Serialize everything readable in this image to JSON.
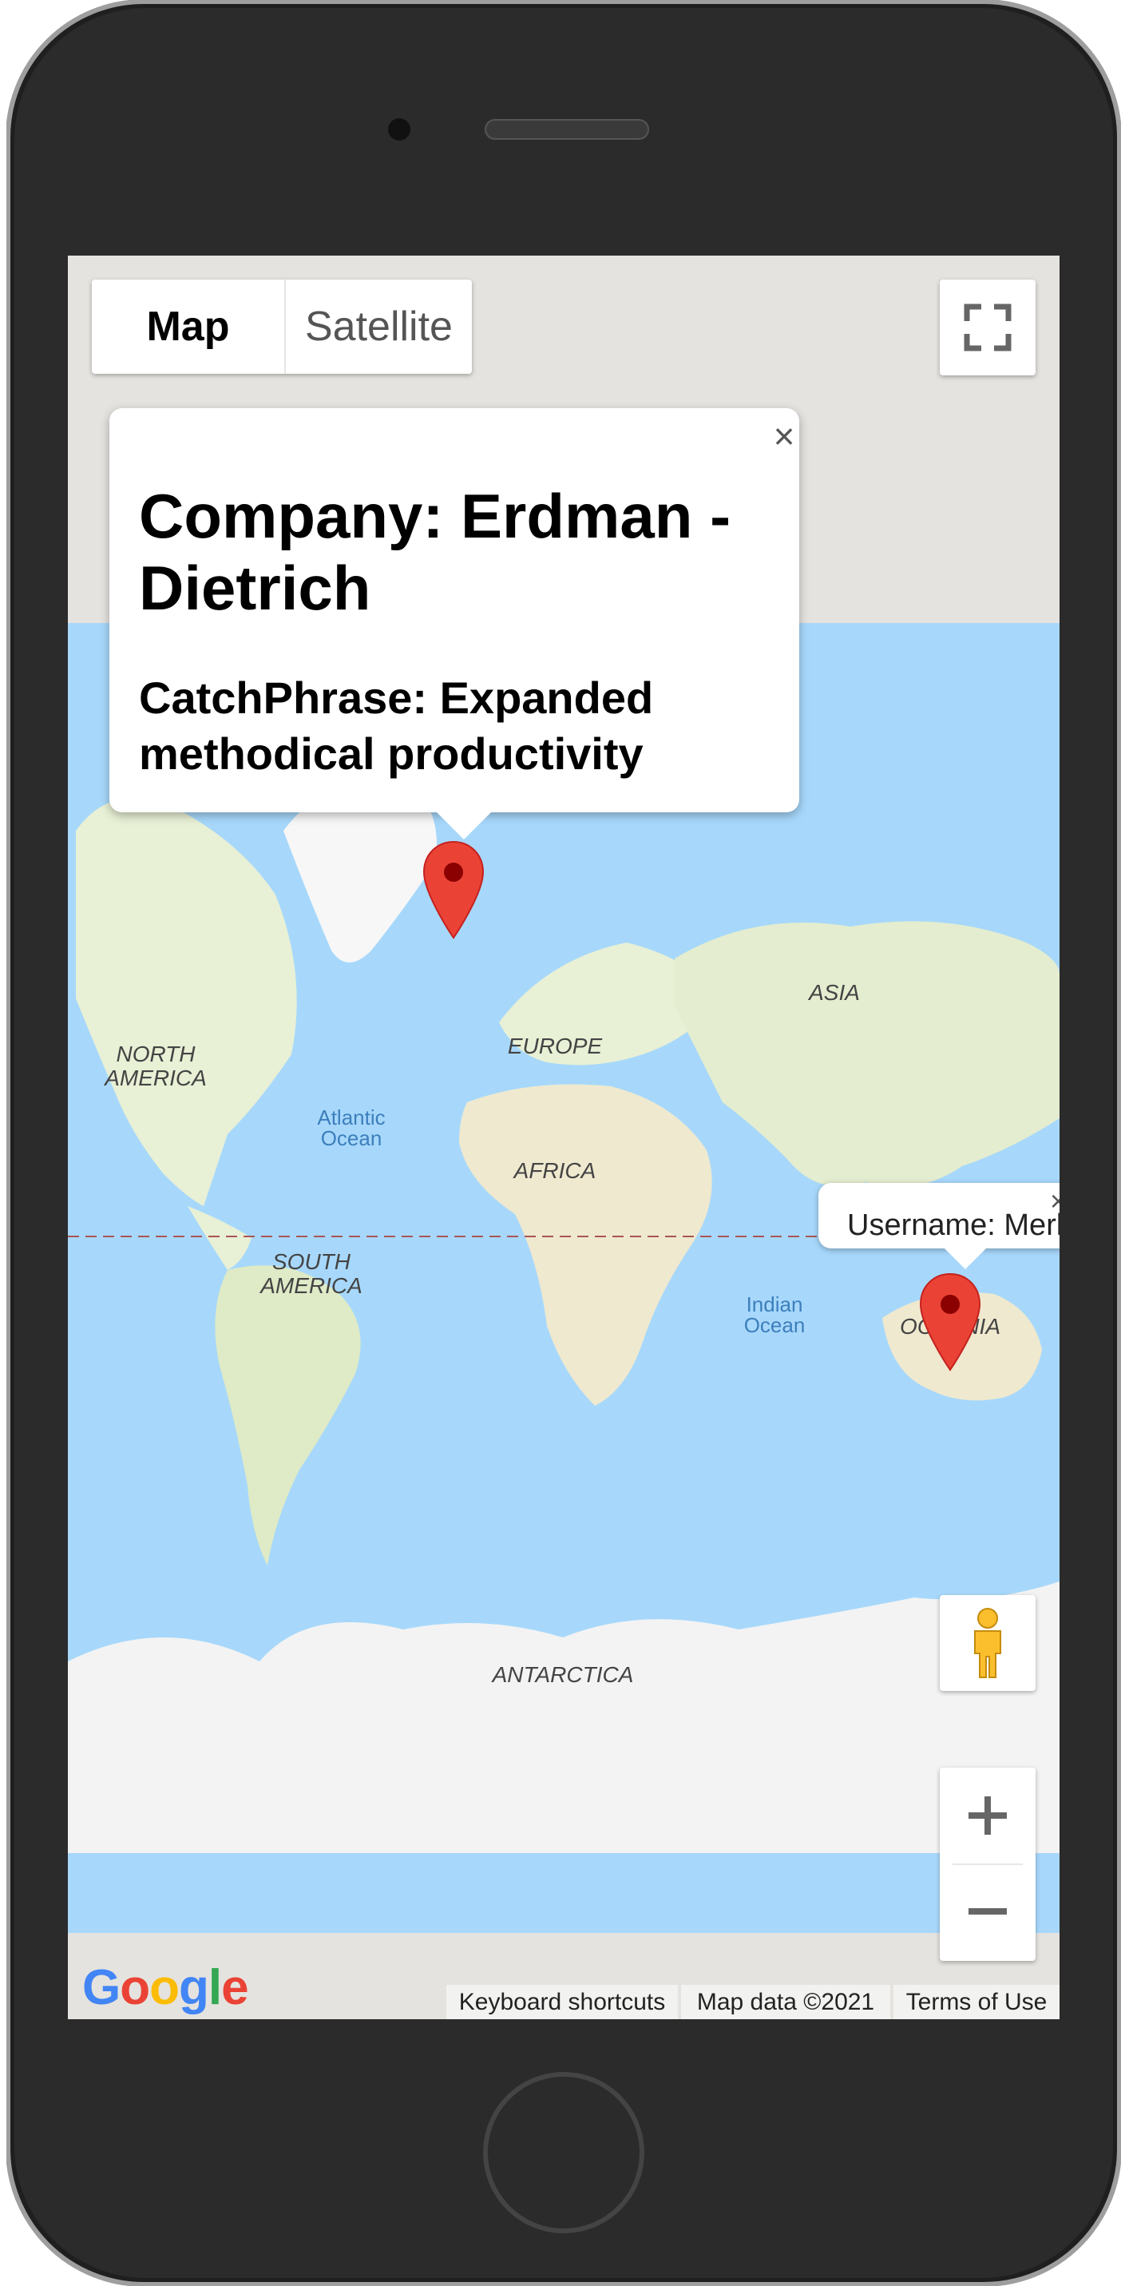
{
  "map_type": {
    "map_label": "Map",
    "satellite_label": "Satellite",
    "selected": "Map"
  },
  "info_window": {
    "company": "Company: Erdman - Dietrich",
    "catchphrase": "CatchPhrase: Expanded methodical productivity",
    "close": "×"
  },
  "info_window_2": {
    "text": "Username: Merl",
    "close": "×"
  },
  "regions": {
    "north_america": "NORTH AMERICA",
    "south_america": "SOUTH AMERICA",
    "europe": "EUROPE",
    "africa": "AFRICA",
    "asia": "ASIA",
    "oceania": "OCEANIA",
    "antarctica": "ANTARCTICA",
    "atlantic": "Atlantic Ocean",
    "indian": "Indian Ocean"
  },
  "attribution": {
    "keyboard": "Keyboard shortcuts",
    "mapdata": "Map data ©2021",
    "terms": "Terms of Use",
    "logo": "Google"
  },
  "zoom": {
    "in": "+",
    "out": "−"
  },
  "icons": {
    "fullscreen": "fullscreen-icon",
    "pegman": "pegman-icon",
    "marker": "marker-icon"
  },
  "colors": {
    "ocean": "#a7d8fb",
    "land": "#e9f1d8",
    "ice": "#f3f3f3",
    "marker": "#ea4335"
  }
}
